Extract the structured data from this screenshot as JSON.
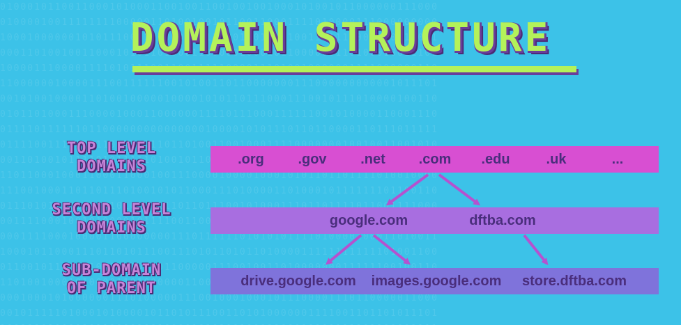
{
  "title": "DOMAIN STRUCTURE",
  "levels": [
    {
      "label_line1": "TOP LEVEL",
      "label_line2": "DOMAINS",
      "items": [
        ".org",
        ".gov",
        ".net",
        ".com",
        ".edu",
        ".uk",
        "..."
      ]
    },
    {
      "label_line1": "SECOND LEVEL",
      "label_line2": "DOMAINS",
      "items": [
        "google.com",
        "dftba.com"
      ]
    },
    {
      "label_line1": "SUB-DOMAIN",
      "label_line2": "OF PARENT",
      "items": [
        "drive.google.com",
        "images.google.com",
        "store.dftba.com"
      ]
    }
  ],
  "edges": [
    {
      "from": ".com",
      "to": "google.com"
    },
    {
      "from": ".com",
      "to": "dftba.com"
    },
    {
      "from": "google.com",
      "to": "drive.google.com"
    },
    {
      "from": "google.com",
      "to": "images.google.com"
    },
    {
      "from": "dftba.com",
      "to": "store.dftba.com"
    }
  ],
  "colors": {
    "background": "#3cc2e8",
    "title": "#b4f25a",
    "title_shadow": "#6a3d9a",
    "tld_band": "#d84fd2",
    "sld_band": "#a86ee0",
    "sub_band": "#7f73db",
    "node_text": "#4a2e7c",
    "arrow": "#b552cf",
    "label": "#c684d8"
  }
}
